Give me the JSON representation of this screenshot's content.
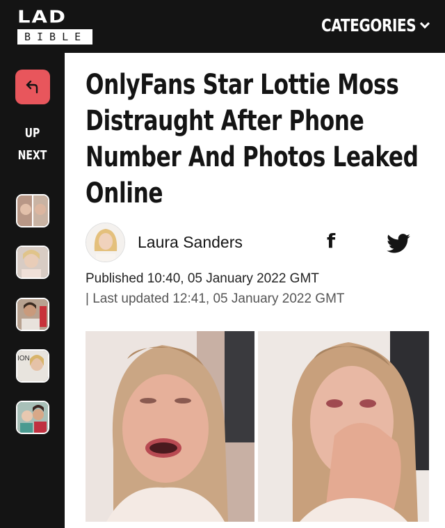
{
  "header": {
    "logo_top": "LAD",
    "logo_bottom": "BIBLE",
    "categories_label": "CATEGORIES"
  },
  "sidebar": {
    "back_icon": "back-arrow-icon",
    "up_label": "UP",
    "next_label": "NEXT",
    "thumbnails": [
      {
        "icon": "thumbnail-image"
      },
      {
        "icon": "thumbnail-image"
      },
      {
        "icon": "thumbnail-image"
      },
      {
        "icon": "thumbnail-image"
      },
      {
        "icon": "thumbnail-image"
      }
    ]
  },
  "article": {
    "title_lines": [
      "OnlyFans Star Lottie Moss",
      "Distraught After Phone",
      "Number And Photos Leaked",
      "Online"
    ],
    "author": "Laura Sanders",
    "facebook_glyph": "f",
    "published": "Published 10:40, 05 January 2022 GMT",
    "updated": "| Last updated 12:41, 05 January 2022 GMT"
  },
  "colors": {
    "background_dark": "#141414",
    "accent": "#e8565c",
    "card": "#ffffff"
  }
}
